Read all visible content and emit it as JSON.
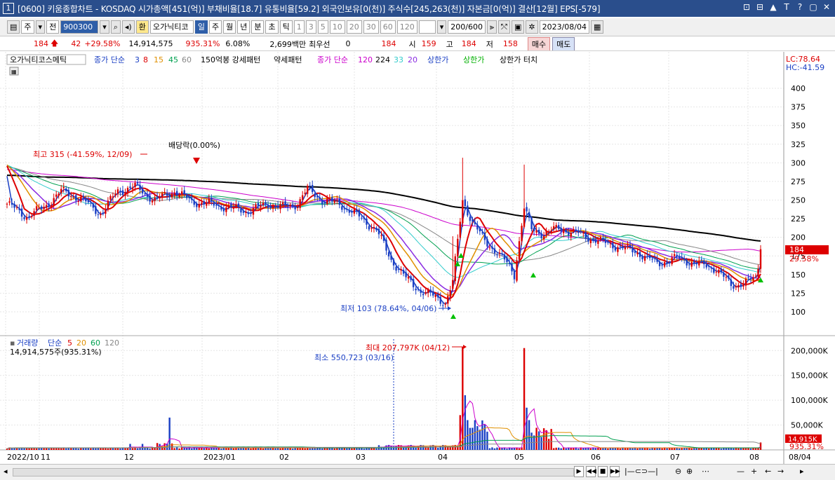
{
  "window": {
    "screen_no": "1",
    "title": "[0600] 키움종합차트 - KOSDAQ 시가총액[451(억)] 부채비율[18.7] 유통비율[59.2] 외국인보유[0(천)] 주식수[245,263(천)] 자본금[0(억)] 결산[12월] EPS[-579]",
    "controls": [
      "⊡",
      "⊟",
      "▲",
      "T",
      "?",
      "▢",
      "✕"
    ]
  },
  "toolbar": {
    "mode1": "주",
    "mode2": "전",
    "code": "900300",
    "exchange_btn": "환",
    "stock_name": "오가닉티코",
    "periods": [
      "일",
      "주",
      "월",
      "년",
      "분",
      "초",
      "틱"
    ],
    "selected_period": "일",
    "minute_options": [
      "1",
      "3",
      "5",
      "10",
      "20",
      "30",
      "60",
      "120"
    ],
    "count": "200/600",
    "date": "2023/08/04"
  },
  "quote": {
    "price": "184",
    "change": "42",
    "change_pct": "+29.58%",
    "volume": "14,914,575",
    "volume_ratio": "935.31%",
    "turnover": "6.08%",
    "amount": "2,699백만",
    "best_bid_label": "최우선",
    "best_bid": "0",
    "best_ask": "184",
    "open_label": "시",
    "open": "159",
    "high_label": "고",
    "high": "184",
    "low_label": "저",
    "low": "158",
    "buy_label": "매수",
    "sell_label": "매도"
  },
  "colors": {
    "up": "#dd0000",
    "down": "#1a3fc4",
    "ma3": "#1a3fc4",
    "ma8": "#dd0000",
    "ma15": "#e09000",
    "ma45": "#00a050",
    "ma60": "#888888",
    "ma120": "#cc00cc",
    "ma224": "#000000",
    "ma33": "#33cccc",
    "ma20": "#8a2be2"
  },
  "price_legend": {
    "name": "오가닉티코스메틱",
    "ma_label": "종가 단순",
    "periods_a": [
      "3",
      "8",
      "15",
      "45",
      "60"
    ],
    "pattern1": "150억봉 강세패턴",
    "pattern2": "약세패턴",
    "ma_label2": "종가 단순",
    "periods_b": [
      "120",
      "224",
      "33",
      "20"
    ],
    "limit_up": "상한가",
    "limit_up2": "상한가",
    "limit_touch": "상한가 터치"
  },
  "volume_legend": {
    "name": "거래량",
    "ma_label": "단순",
    "periods": [
      "5",
      "20",
      "60",
      "120"
    ],
    "current": "14,914,575주(935.31%)"
  },
  "chart_data": {
    "type": "candlestick",
    "price_axis": {
      "min": 80,
      "max": 425,
      "ticks": [
        100,
        125,
        150,
        175,
        200,
        225,
        250,
        275,
        300,
        325,
        350,
        375,
        400
      ]
    },
    "volume_axis": {
      "min": 0,
      "max": 230000,
      "tick_values": [
        50000,
        100000,
        150000,
        200000
      ],
      "tick_labels": [
        "50,000K",
        "100,000K",
        "150,000K",
        "200,000K"
      ]
    },
    "x_labels": [
      "2022/10",
      "11",
      "12",
      "2023/01",
      "02",
      "03",
      "04",
      "05",
      "06",
      "07",
      "08"
    ],
    "x_date_right": "08/04",
    "annotations": {
      "high": "최고 315 (-41.59%, 12/09)",
      "dividend": "배당락(0.00%)",
      "low": "최저 103 (78.64%, 04/06)",
      "vol_max": "최대 207,797K (04/12)",
      "vol_min": "최소 550,723 (03/16)"
    },
    "right_labels": {
      "lc": "LC:78.64",
      "hc": "HC:-41.59",
      "price_tag": "184",
      "pct_tag": "29.58%",
      "vol_tag": "14,915K",
      "volpct_tag": "935.31%"
    },
    "anchors": [
      {
        "i": 0,
        "v": 245
      },
      {
        "i": 8,
        "v": 228
      },
      {
        "i": 15,
        "v": 240
      },
      {
        "i": 22,
        "v": 262
      },
      {
        "i": 30,
        "v": 252
      },
      {
        "i": 38,
        "v": 232
      },
      {
        "i": 45,
        "v": 262
      },
      {
        "i": 52,
        "v": 268
      },
      {
        "i": 60,
        "v": 250
      },
      {
        "i": 68,
        "v": 262
      },
      {
        "i": 75,
        "v": 248
      },
      {
        "i": 82,
        "v": 245
      },
      {
        "i": 90,
        "v": 240
      },
      {
        "i": 98,
        "v": 235
      },
      {
        "i": 106,
        "v": 245
      },
      {
        "i": 112,
        "v": 240
      },
      {
        "i": 118,
        "v": 245
      },
      {
        "i": 122,
        "v": 265
      },
      {
        "i": 128,
        "v": 250
      },
      {
        "i": 135,
        "v": 245
      },
      {
        "i": 142,
        "v": 230
      },
      {
        "i": 150,
        "v": 210
      },
      {
        "i": 156,
        "v": 170
      },
      {
        "i": 162,
        "v": 145
      },
      {
        "i": 168,
        "v": 128
      },
      {
        "i": 174,
        "v": 120
      },
      {
        "i": 178,
        "v": 112
      },
      {
        "i": 181,
        "v": 140
      },
      {
        "i": 185,
        "v": 250
      },
      {
        "i": 189,
        "v": 220
      },
      {
        "i": 194,
        "v": 195
      },
      {
        "i": 199,
        "v": 180
      },
      {
        "i": 203,
        "v": 165
      },
      {
        "i": 206,
        "v": 150
      },
      {
        "i": 210,
        "v": 240
      },
      {
        "i": 213,
        "v": 210
      },
      {
        "i": 218,
        "v": 205
      },
      {
        "i": 224,
        "v": 212
      },
      {
        "i": 232,
        "v": 205
      },
      {
        "i": 240,
        "v": 195
      },
      {
        "i": 248,
        "v": 188
      },
      {
        "i": 256,
        "v": 180
      },
      {
        "i": 264,
        "v": 165
      },
      {
        "i": 272,
        "v": 172
      },
      {
        "i": 280,
        "v": 165
      },
      {
        "i": 288,
        "v": 158
      },
      {
        "i": 294,
        "v": 135
      },
      {
        "i": 300,
        "v": 140
      },
      {
        "i": 304,
        "v": 145
      },
      {
        "i": 306,
        "v": 175
      }
    ]
  }
}
